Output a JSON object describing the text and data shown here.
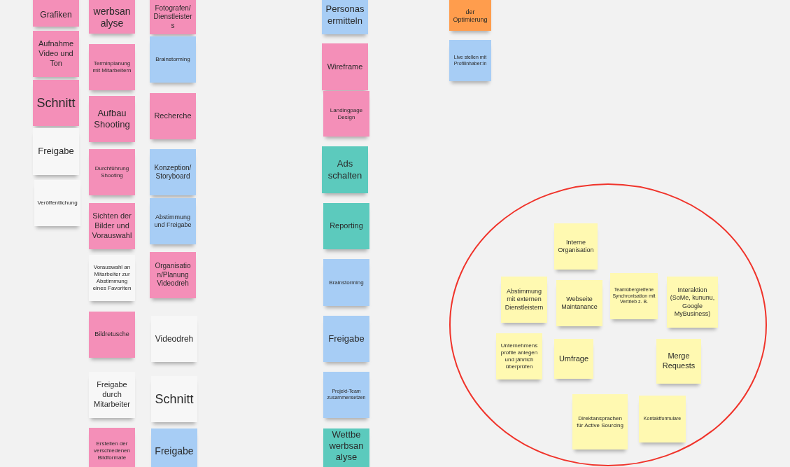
{
  "notes": [
    {
      "text": "Grafiken",
      "color": "#f48fb8"
    },
    {
      "text": "Aufnahme Video und Ton",
      "color": "#f48fb8"
    },
    {
      "text": "Schnitt",
      "color": "#f48fb8"
    },
    {
      "text": "Freigabe",
      "color": "#f7f7f7"
    },
    {
      "text": "Veröffentlichung",
      "color": "#f7f7f7"
    },
    {
      "text": "werbsan\nalyse",
      "color": "#f48fb8"
    },
    {
      "text": "Terminplanung mit Mitarbeitern",
      "color": "#f48fb8"
    },
    {
      "text": "Aufbau Shooting",
      "color": "#f48fb8"
    },
    {
      "text": "Durchführung Shooting",
      "color": "#f48fb8"
    },
    {
      "text": "Sichten der Bilder und Vorauswahl",
      "color": "#f48fb8"
    },
    {
      "text": "Vorauswahl an Mitarbeiter zur Abstimmung eines Favoriten",
      "color": "#f7f7f7"
    },
    {
      "text": "Bildretusche",
      "color": "#f48fb8"
    },
    {
      "text": "Freigabe durch Mitarbeiter",
      "color": "#f7f7f7"
    },
    {
      "text": "Erstellen der verschiedenen Bildformate",
      "color": "#f48fb8"
    },
    {
      "text": "Fotografen/\nDienstleister\ns",
      "color": "#f48fb8"
    },
    {
      "text": "Brainstorming",
      "color": "#a7cdf5"
    },
    {
      "text": "Recherche",
      "color": "#f48fb8"
    },
    {
      "text": "Konzeption/\nStoryboard",
      "color": "#a7cdf5"
    },
    {
      "text": "Abstimmung und Freigabe",
      "color": "#a7cdf5"
    },
    {
      "text": "Organisatio\nn/Planung\nVideodreh",
      "color": "#f48fb8"
    },
    {
      "text": "Videodreh",
      "color": "#f7f7f7"
    },
    {
      "text": "Schnitt",
      "color": "#f7f7f7"
    },
    {
      "text": "Freigabe",
      "color": "#a7cdf5"
    },
    {
      "text": "Personas ermitteln",
      "color": "#a7cdf5"
    },
    {
      "text": "Wireframe",
      "color": "#f48fb8"
    },
    {
      "text": "Landingpage Design",
      "color": "#f48fb8"
    },
    {
      "text": "Ads schalten",
      "color": "#5ccabd"
    },
    {
      "text": "Reporting",
      "color": "#5ccabd"
    },
    {
      "text": "Brainstorming",
      "color": "#a7cdf5"
    },
    {
      "text": "Freigabe",
      "color": "#a7cdf5"
    },
    {
      "text": "Projekt-Team zusammensetzen",
      "color": "#a7cdf5"
    },
    {
      "text": "Wettbe\nwerbsan\nalyse",
      "color": "#5ccabd"
    },
    {
      "text": "der Optimierung",
      "color": "#ff9d4d"
    },
    {
      "text": "Live stellen mit Profilinhaber:in",
      "color": "#a7cdf5"
    },
    {
      "text": "Interne Organisation",
      "color": "#fff9b1"
    },
    {
      "text": "Abstimmung mit externen Dienstleistern",
      "color": "#fff9b1"
    },
    {
      "text": "Webseite Maintanance",
      "color": "#fff9b1"
    },
    {
      "text": "Teamübergreifene Synchronisation mit Vertrieb z. B.",
      "color": "#fff9b1"
    },
    {
      "text": "Interaktion (SoMe, kununu, Google MyBusiness)",
      "color": "#fff9b1"
    },
    {
      "text": "Unternehmens profile anlegen und jährlich überprüfen",
      "color": "#fff9b1"
    },
    {
      "text": "Umfrage",
      "color": "#fff9b1"
    },
    {
      "text": "Merge Requests",
      "color": "#fff9b1"
    },
    {
      "text": "Direktansprachen für Active Sourcing",
      "color": "#fff9b1"
    },
    {
      "text": "Kontaktformulare",
      "color": "#fff9b1"
    }
  ]
}
